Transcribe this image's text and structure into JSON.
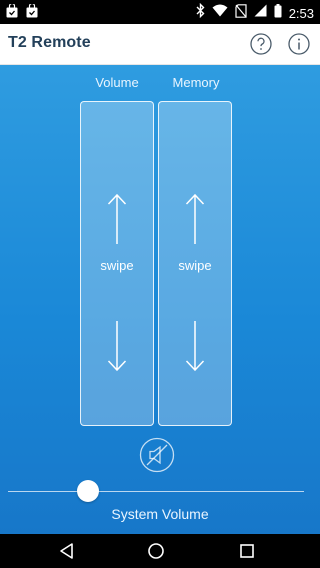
{
  "status_bar": {
    "time": "2:53",
    "icons": [
      "bag-notification-icon",
      "bag-notification-icon",
      "bluetooth-icon",
      "wifi-icon",
      "no-sim-icon",
      "signal-icon",
      "battery-icon"
    ]
  },
  "app_bar": {
    "title": "T2 Remote",
    "help_icon": "question-circle-icon",
    "info_icon": "info-circle-icon"
  },
  "controls": {
    "volume": {
      "label": "Volume",
      "hint": "swipe"
    },
    "memory": {
      "label": "Memory",
      "hint": "swipe"
    },
    "mute_icon": "speaker-muted-icon"
  },
  "system_volume": {
    "label": "System Volume",
    "value_fraction": 0.27
  },
  "nav_bar": {
    "icons": [
      "back-triangle-icon",
      "home-circle-icon",
      "recents-square-icon"
    ]
  },
  "colors": {
    "accent": "#1f8fdc",
    "title": "#23405a"
  }
}
